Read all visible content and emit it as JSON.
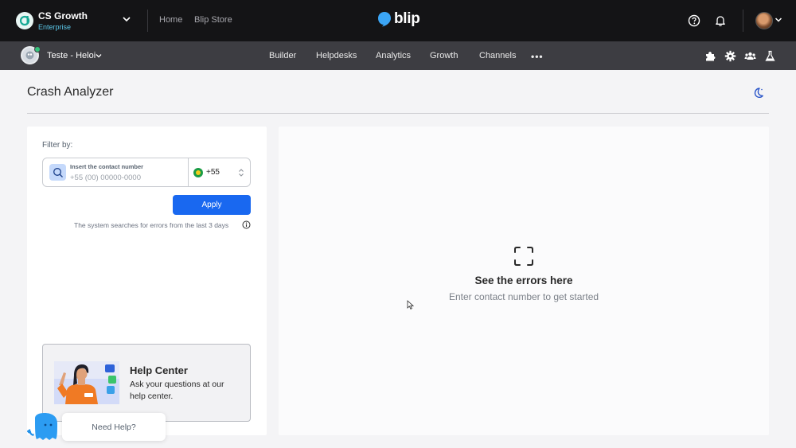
{
  "topbar": {
    "org_name": "CS Growth",
    "org_plan": "Enterprise",
    "links": [
      "Home",
      "Blip Store"
    ],
    "brand": "blip",
    "icons": [
      "help-circle-icon",
      "bell-icon",
      "avatar",
      "chevron-down-icon"
    ]
  },
  "subbar": {
    "bot_name": "Teste - Heloi",
    "nav": [
      "Builder",
      "Helpdesks",
      "Analytics",
      "Growth",
      "Channels"
    ],
    "more": "•••",
    "icons": [
      "puzzle-icon",
      "gear-icon",
      "users-icon",
      "flask-icon"
    ]
  },
  "page": {
    "title": "Crash Analyzer",
    "theme_icon": "moon-icon"
  },
  "filter": {
    "label": "Filter by:",
    "field_label": "Insert the contact number",
    "placeholder": "+55 (00) 00000-0000",
    "country_code": "+55",
    "apply_label": "Apply",
    "hint": "The system searches for errors from the last 3 days"
  },
  "help_card": {
    "title": "Help Center",
    "text": "Ask your questions at our help center."
  },
  "empty_state": {
    "title": "See the errors here",
    "subtitle": "Enter contact number to get started"
  },
  "floating": {
    "need_help": "Need Help?"
  },
  "colors": {
    "accent": "#1968f0",
    "topbar": "#141416",
    "subbar": "#3d3d42",
    "brand": "#3ba5f5"
  }
}
